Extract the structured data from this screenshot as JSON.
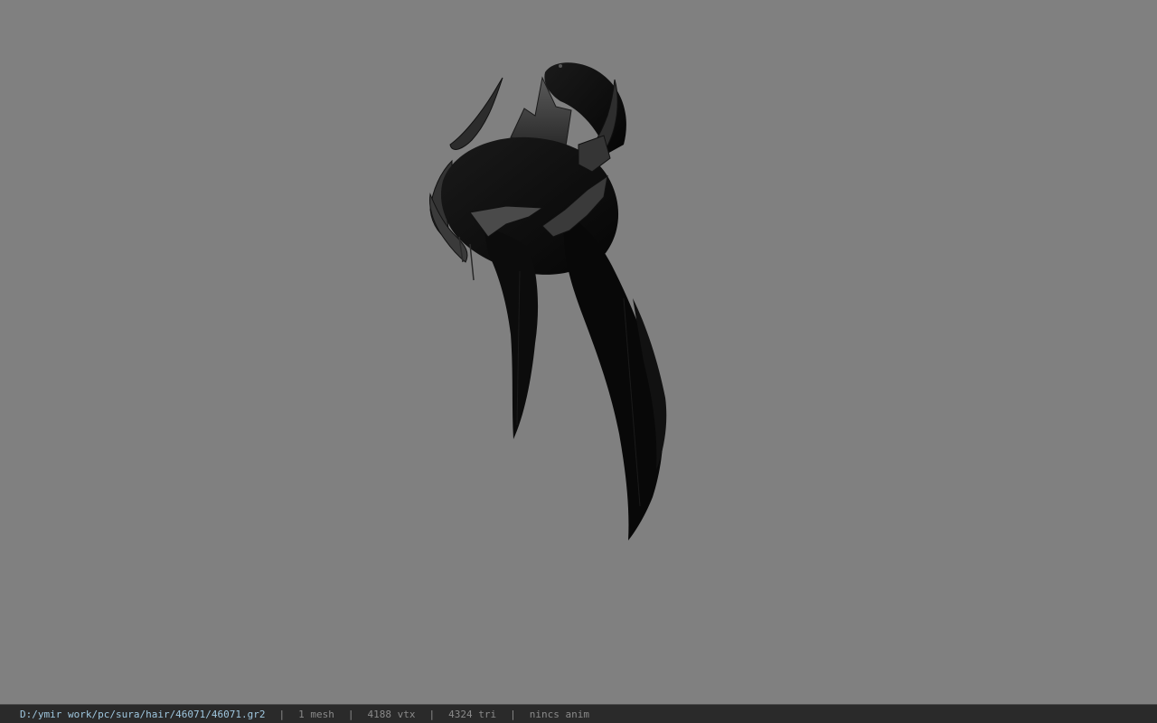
{
  "viewport": {
    "background_color": "#808080",
    "model_color": "#0d0d0d",
    "ornament_color": "#3a3a3a"
  },
  "statusbar": {
    "path": "D:/ymir work/pc/sura/hair/46071/46071.gr2",
    "separator": "|",
    "mesh_count": "1 mesh",
    "vertex_count": "4188 vtx",
    "triangle_count": "4324 tri",
    "anim_status": "nincs anim",
    "path_color": "#9fc7df"
  }
}
